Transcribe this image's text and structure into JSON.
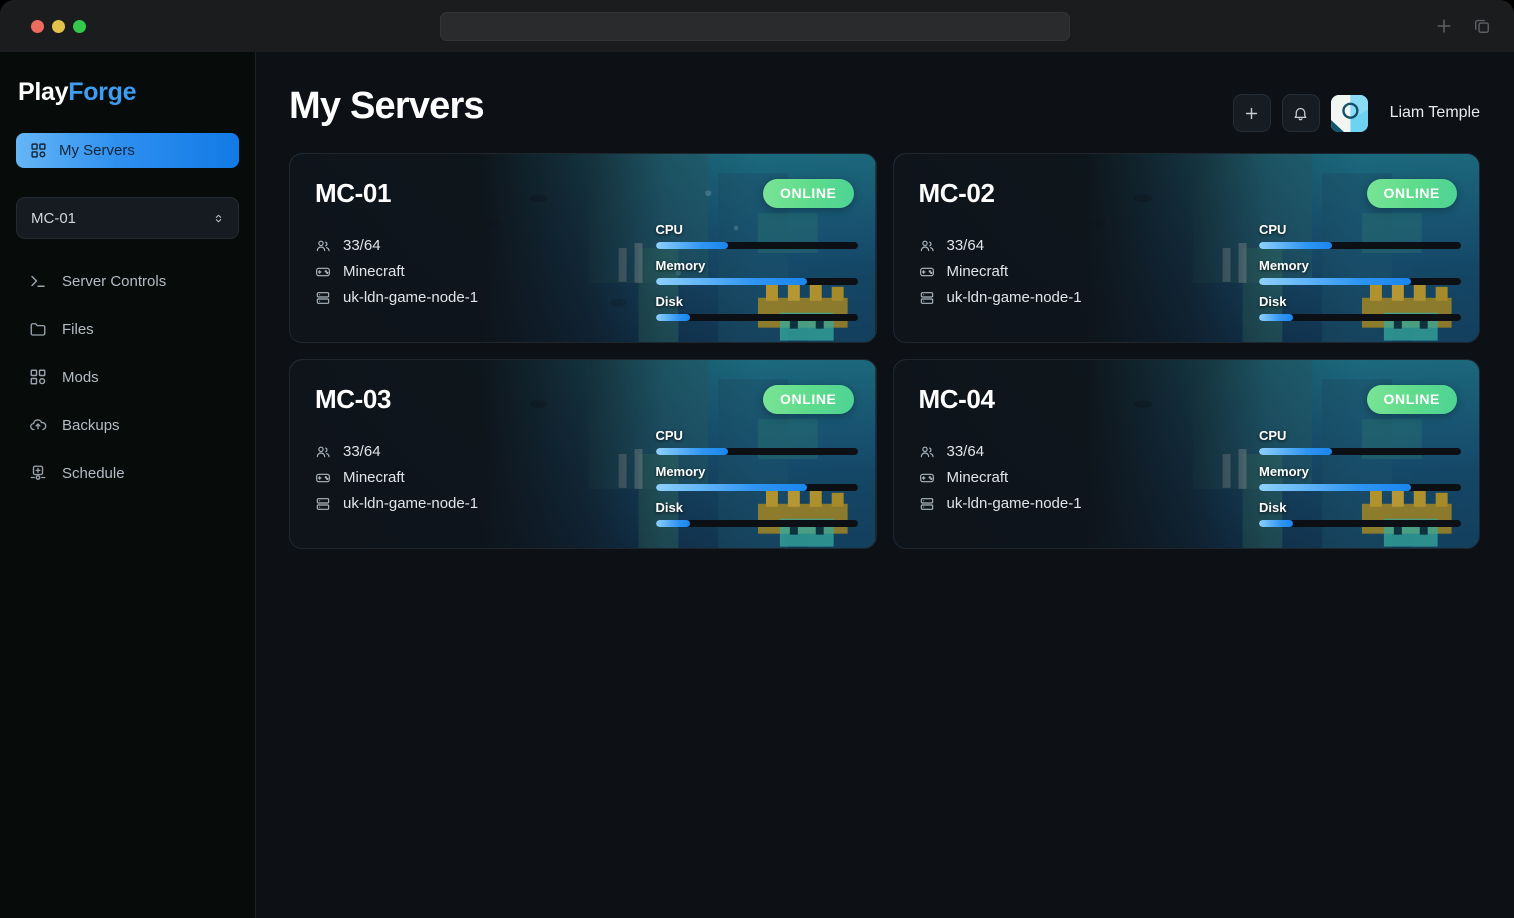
{
  "browser": {
    "address_value": "",
    "address_placeholder": "",
    "new_tab_icon": "plus-icon",
    "tab_overview_icon": "copy-stack-icon",
    "traffic_lights": [
      "close-red",
      "minimize-yellow",
      "maximize-green"
    ]
  },
  "sidebar": {
    "brand": {
      "first": "Play",
      "second": "Forge"
    },
    "active_item": {
      "label": "My Servers",
      "icon": "grid-icon"
    },
    "server_select": {
      "value": "MC-01",
      "icon": "chevron-updown-icon"
    },
    "items": [
      {
        "label": "Server Controls",
        "icon": "terminal-icon"
      },
      {
        "label": "Files",
        "icon": "folder-icon"
      },
      {
        "label": "Mods",
        "icon": "grid-icon"
      },
      {
        "label": "Backups",
        "icon": "cloud-upload-icon"
      },
      {
        "label": "Schedule",
        "icon": "schedule-icon"
      }
    ]
  },
  "header": {
    "title": "My Servers",
    "add_button_icon": "plus-icon",
    "notifications_icon": "bell-icon",
    "user_name": "Liam Temple",
    "avatar_icon": "user-avatar"
  },
  "metric_labels": {
    "cpu": "CPU",
    "memory": "Memory",
    "disk": "Disk"
  },
  "colors": {
    "accent_blue": "#2f90ef",
    "brand_blue": "#3f9cf0",
    "status_green": "#5fdc8c",
    "card_bg": "#10161d",
    "sidebar_bg": "#070b0a",
    "main_bg": "#0d1014"
  },
  "cards": [
    {
      "name": "MC-01",
      "status": "ONLINE",
      "players": "33/64",
      "game": "Minecraft",
      "node": "uk-ldn-game-node-1",
      "metrics": {
        "cpu": 36,
        "memory": 75,
        "disk": 17
      }
    },
    {
      "name": "MC-02",
      "status": "ONLINE",
      "players": "33/64",
      "game": "Minecraft",
      "node": "uk-ldn-game-node-1",
      "metrics": {
        "cpu": 36,
        "memory": 75,
        "disk": 17
      }
    },
    {
      "name": "MC-03",
      "status": "ONLINE",
      "players": "33/64",
      "game": "Minecraft",
      "node": "uk-ldn-game-node-1",
      "metrics": {
        "cpu": 36,
        "memory": 75,
        "disk": 17
      }
    },
    {
      "name": "MC-04",
      "status": "ONLINE",
      "players": "33/64",
      "game": "Minecraft",
      "node": "uk-ldn-game-node-1",
      "metrics": {
        "cpu": 36,
        "memory": 75,
        "disk": 17
      }
    }
  ]
}
